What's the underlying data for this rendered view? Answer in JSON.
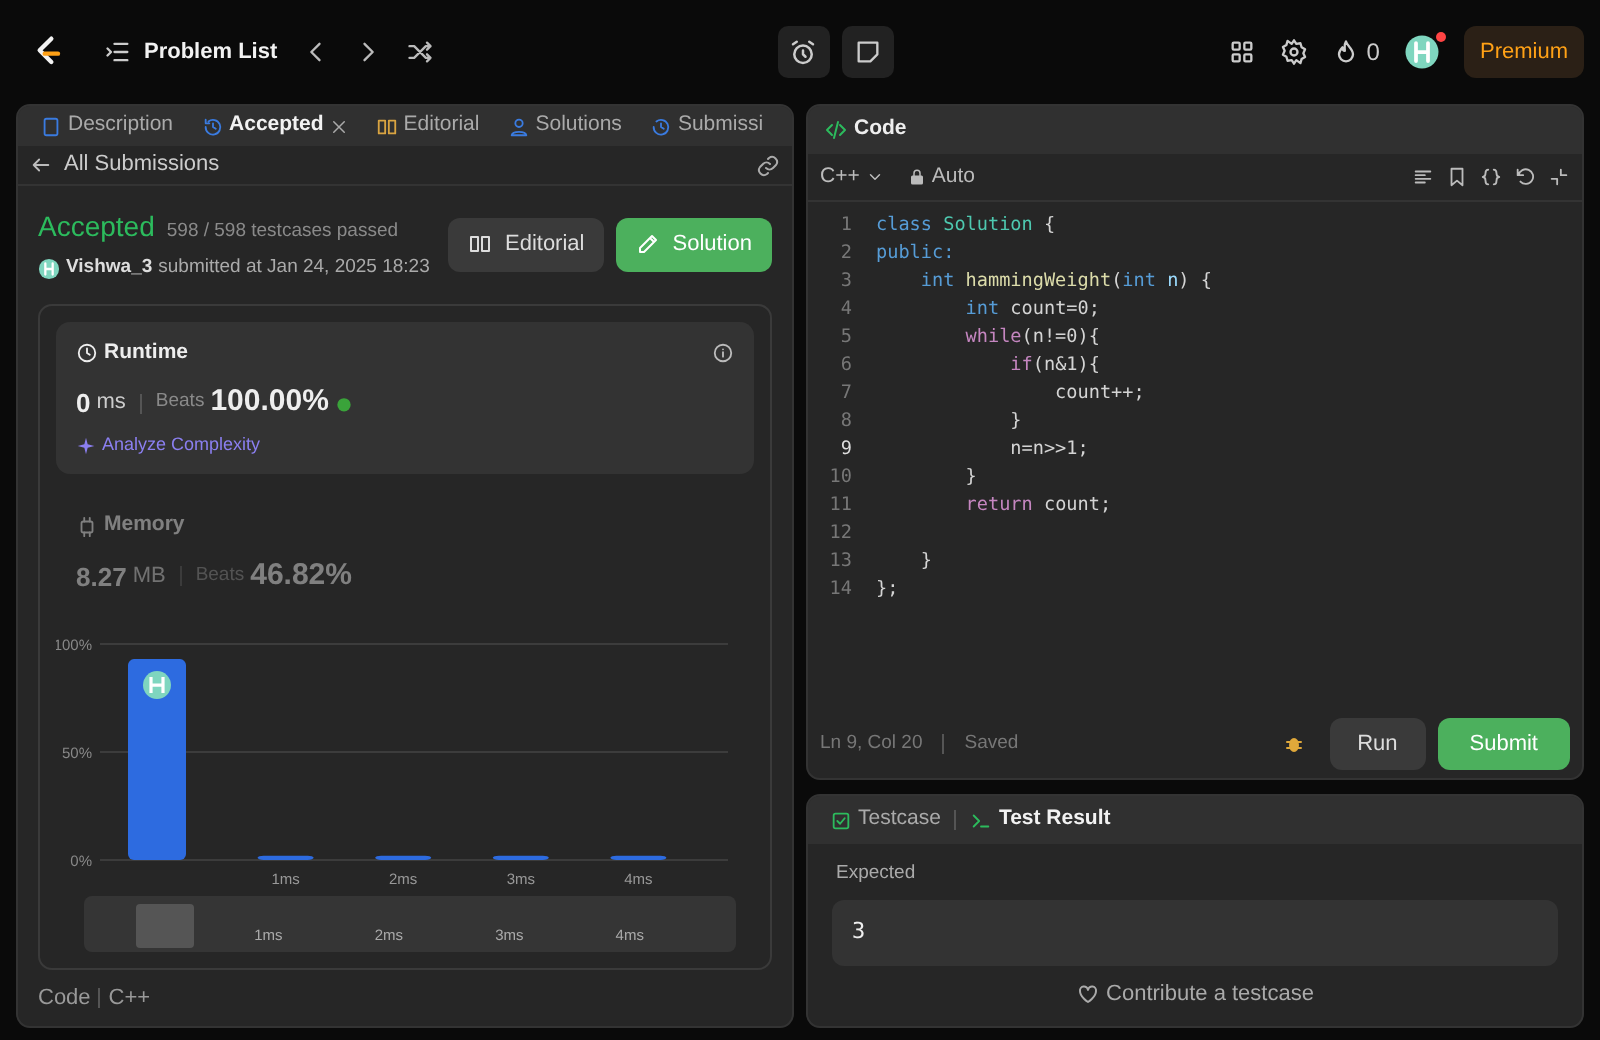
{
  "topbar": {
    "title": "Problem List",
    "streak": "0",
    "premium": "Premium",
    "avatar_notification": true
  },
  "left_panel": {
    "tabs": [
      {
        "label": "Description",
        "selected": false,
        "closable": false
      },
      {
        "label": "Accepted",
        "selected": true,
        "closable": true
      },
      {
        "label": "Editorial",
        "selected": false,
        "closable": false
      },
      {
        "label": "Solutions",
        "selected": false,
        "closable": false
      },
      {
        "label": "Submissi",
        "selected": false,
        "closable": false
      }
    ],
    "back_link": "All Submissions",
    "result": {
      "status": "Accepted",
      "testcases": "598 / 598 testcases passed",
      "user": "Vishwa_3",
      "submitted": "submitted at Jan 24, 2025 18:23"
    },
    "buttons": [
      {
        "label": "Editorial",
        "kind": "secondary"
      },
      {
        "label": "Solution",
        "kind": "primary"
      }
    ],
    "stats": [
      {
        "title": "Runtime",
        "value": "0",
        "unit": "ms",
        "beats_label": "Beats",
        "beats": "100.00%",
        "analyze": "Analyze Complexity",
        "selected": true
      },
      {
        "title": "Memory",
        "value": "8.27",
        "unit": "MB",
        "beats_label": "Beats",
        "beats": "46.82%",
        "selected": false
      }
    ],
    "chart_data": {
      "type": "bar",
      "categories": [
        null,
        "1ms",
        "2ms",
        "3ms",
        "4ms"
      ],
      "values": [
        93,
        2,
        2,
        2,
        2
      ],
      "ylim": [
        0,
        100
      ],
      "yticks": [
        {
          "value": 0,
          "label": "0%"
        },
        {
          "value": 50,
          "label": "50%"
        },
        {
          "value": 100,
          "label": "100%"
        }
      ]
    },
    "navigator_labels": [
      "1ms",
      "2ms",
      "3ms",
      "4ms"
    ],
    "footer": [
      "Code",
      "C++"
    ]
  },
  "code_panel": {
    "title": "Code",
    "language": "C++",
    "mode": "Auto",
    "lines": [
      {
        "number": "1",
        "current": false,
        "tokens": [
          {
            "kind": "kw",
            "text": "class"
          },
          {
            "kind": "type",
            "text": " Solution"
          },
          {
            "kind": "plain",
            "text": " {"
          }
        ]
      },
      {
        "number": "2",
        "current": false,
        "tokens": [
          {
            "kind": "kw",
            "text": "public:"
          }
        ]
      },
      {
        "number": "3",
        "current": false,
        "tokens": [
          {
            "kind": "kw",
            "text": "    int"
          },
          {
            "kind": "fn",
            "text": " hammingWeight"
          },
          {
            "kind": "plain",
            "text": "("
          },
          {
            "kind": "kw",
            "text": "int"
          },
          {
            "kind": "var",
            "text": " n"
          },
          {
            "kind": "plain",
            "text": ") {"
          }
        ]
      },
      {
        "number": "4",
        "current": false,
        "tokens": [
          {
            "kind": "kw",
            "text": "        int"
          },
          {
            "kind": "plain",
            "text": " count=0;"
          }
        ]
      },
      {
        "number": "5",
        "current": false,
        "tokens": [
          {
            "kind": "ctrl",
            "text": "        while"
          },
          {
            "kind": "plain",
            "text": "(n!=0){"
          }
        ]
      },
      {
        "number": "6",
        "current": false,
        "tokens": [
          {
            "kind": "ctrl",
            "text": "            if"
          },
          {
            "kind": "plain",
            "text": "(n&1){"
          }
        ]
      },
      {
        "number": "7",
        "current": false,
        "tokens": [
          {
            "kind": "plain",
            "text": "                count++;"
          }
        ]
      },
      {
        "number": "8",
        "current": false,
        "tokens": [
          {
            "kind": "plain",
            "text": "            }"
          }
        ]
      },
      {
        "number": "9",
        "current": true,
        "tokens": [
          {
            "kind": "plain",
            "text": "            n=n>>1;"
          }
        ]
      },
      {
        "number": "10",
        "current": false,
        "tokens": [
          {
            "kind": "plain",
            "text": "        }"
          }
        ]
      },
      {
        "number": "11",
        "current": false,
        "tokens": [
          {
            "kind": "ctrl",
            "text": "        return"
          },
          {
            "kind": "plain",
            "text": " count;"
          }
        ]
      },
      {
        "number": "12",
        "current": false
      },
      {
        "number": "13",
        "current": false,
        "tokens": [
          {
            "kind": "plain",
            "text": "    }"
          }
        ]
      },
      {
        "number": "14",
        "current": false,
        "tokens": [
          {
            "kind": "plain",
            "text": "};"
          }
        ]
      }
    ],
    "cursor": "Ln 9, Col 20",
    "saved": "Saved",
    "buttons": [
      {
        "label": "Run",
        "kind": "secondary"
      },
      {
        "label": "Submit",
        "kind": "primary"
      }
    ]
  },
  "test_panel": {
    "tabs": [
      {
        "label": "Testcase",
        "selected": false
      },
      {
        "label": "Test Result",
        "selected": true
      }
    ],
    "expected_label": "Expected",
    "expected": "3",
    "contribute": "Contribute a testcase"
  }
}
